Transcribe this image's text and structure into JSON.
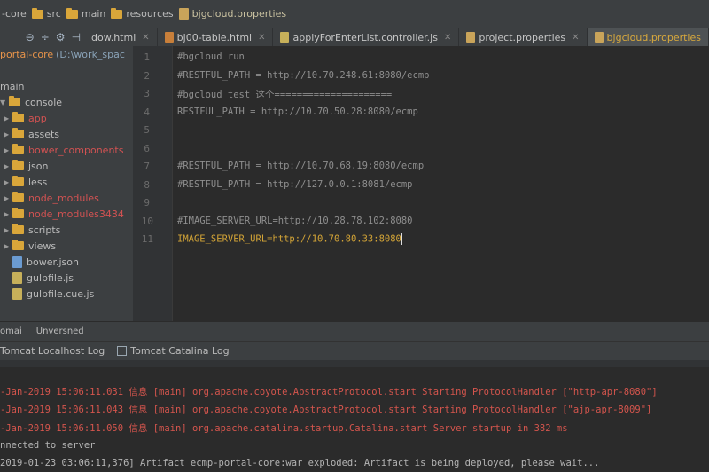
{
  "breadcrumbs": [
    {
      "label": "-core",
      "icon": "none"
    },
    {
      "label": "src",
      "icon": "folder-icon"
    },
    {
      "label": "main",
      "icon": "folder-icon"
    },
    {
      "label": "resources",
      "icon": "folder-icon"
    },
    {
      "label": "bjgcloud.properties",
      "icon": "properties-file-icon",
      "active": true
    }
  ],
  "toolbar": {
    "icons": [
      "target-icon",
      "split-icon",
      "gear-icon",
      "hide-icon"
    ]
  },
  "tabs": [
    {
      "label": "dow.html",
      "active": false
    },
    {
      "label": "bj00-table.html",
      "active": false
    },
    {
      "label": "applyForEnterList.controller.js",
      "active": false
    },
    {
      "label": "project.properties",
      "active": false
    },
    {
      "label": "bjgcloud.properties",
      "active": true
    }
  ],
  "project": {
    "root_name": "portal-core",
    "root_path": "(D:\\work_spac",
    "items": [
      {
        "label": "main",
        "type": "text",
        "color": "normal"
      },
      {
        "label": "console",
        "type": "folder",
        "color": "normal"
      },
      {
        "label": "app",
        "type": "folder",
        "color": "red"
      },
      {
        "label": "assets",
        "type": "folder",
        "color": "normal"
      },
      {
        "label": "bower_components",
        "type": "folder",
        "color": "red"
      },
      {
        "label": "json",
        "type": "folder",
        "color": "normal"
      },
      {
        "label": "less",
        "type": "folder",
        "color": "normal"
      },
      {
        "label": "node_modules",
        "type": "folder",
        "color": "red"
      },
      {
        "label": "node_modules3434",
        "type": "folder",
        "color": "red"
      },
      {
        "label": "scripts",
        "type": "folder",
        "color": "normal"
      },
      {
        "label": "views",
        "type": "folder",
        "color": "normal"
      },
      {
        "label": "bower.json",
        "type": "json",
        "color": "normal"
      },
      {
        "label": "gulpfile.js",
        "type": "js",
        "color": "normal"
      },
      {
        "label": "gulpfile.cue.js",
        "type": "js",
        "color": "normal"
      }
    ]
  },
  "editor": {
    "line_numbers": [
      "1",
      "2",
      "3",
      "4",
      "5",
      "6",
      "7",
      "8",
      "9",
      "10",
      "11"
    ],
    "lines": [
      "#bgcloud run",
      "#RESTFUL_PATH = http://10.70.248.61:8080/ecmp",
      "#bgcloud test 这个=====================",
      "RESTFUL_PATH = http://10.70.50.28:8080/ecmp",
      "",
      "",
      "#RESTFUL_PATH = http://10.70.68.19:8080/ecmp",
      "#RESTFUL_PATH = http://127.0.0.1:8081/ecmp",
      "",
      "#IMAGE_SERVER_URL=http://10.28.78.102:8080",
      "IMAGE_SERVER_URL=http://10.70.80.33:8080"
    ],
    "current_line": 11
  },
  "bottom_bar": {
    "left_label": "omai",
    "second_label": "Unversned"
  },
  "log_tabs": [
    {
      "label": "Tomcat Localhost Log"
    },
    {
      "label": "Tomcat Catalina Log"
    }
  ],
  "console": {
    "lines": [
      {
        "text": "-Jan-2019 15:06:11.031 信息 [main] org.apache.coyote.AbstractProtocol.start Starting ProtocolHandler [\"http-apr-8080\"]",
        "color": "red"
      },
      {
        "text": "-Jan-2019 15:06:11.043 信息 [main] org.apache.coyote.AbstractProtocol.start Starting ProtocolHandler [\"ajp-apr-8009\"]",
        "color": "red"
      },
      {
        "text": "-Jan-2019 15:06:11.050 信息 [main] org.apache.catalina.startup.Catalina.start Server startup in 382 ms",
        "color": "red"
      },
      {
        "text": "nnected to server",
        "color": "gray"
      },
      {
        "text": "2019-01-23 03:06:11,376] Artifact ecmp-portal-core:war exploded: Artifact is being deployed, please wait...",
        "color": "gray"
      }
    ]
  }
}
